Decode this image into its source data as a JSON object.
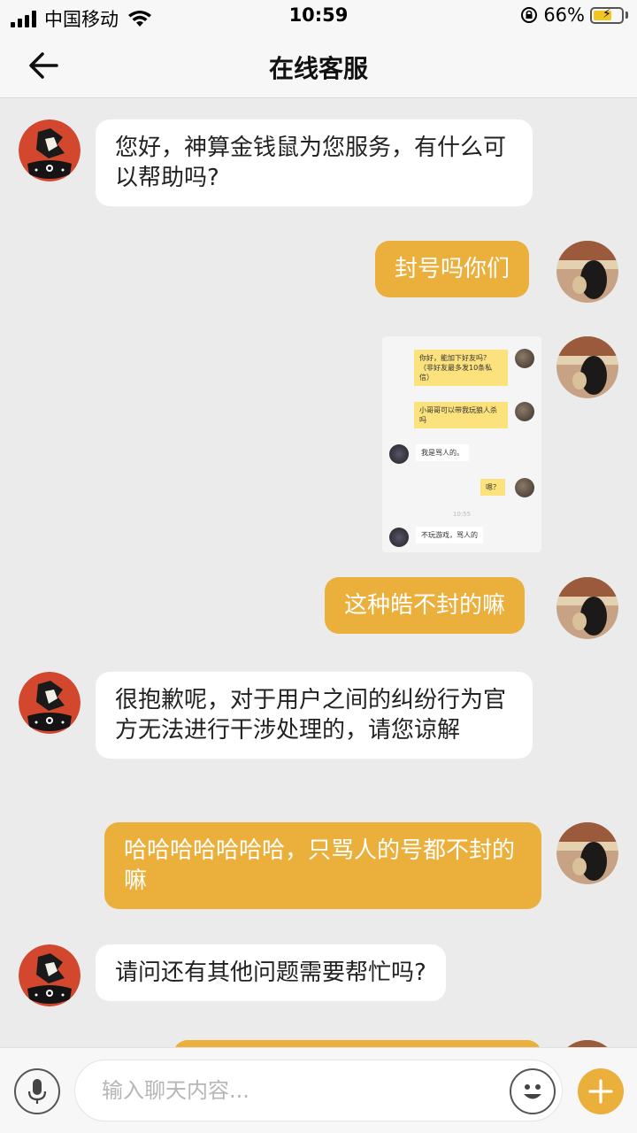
{
  "status_bar": {
    "carrier": "中国移动",
    "time": "10:59",
    "battery_percent": "66%",
    "battery_level": 0.66
  },
  "header": {
    "title": "在线客服",
    "back_icon": "back-arrow-icon"
  },
  "colors": {
    "accent": "#ebaf3b",
    "background": "#ebebeb",
    "incoming_bubble": "#ffffff"
  },
  "messages": [
    {
      "from": "agent",
      "text": "您好，神算金钱鼠为您服务，有什么可以帮助吗?"
    },
    {
      "from": "user",
      "text": "封号吗你们"
    },
    {
      "from": "user",
      "type": "image"
    },
    {
      "from": "user",
      "text": "这种皓不封的嘛"
    },
    {
      "from": "agent",
      "text": "很抱歉呢，对于用户之间的纠纷行为官方无法进行干涉处理的，请您谅解"
    },
    {
      "from": "user",
      "text": "哈哈哈哈哈哈哈，只骂人的号都不封的嘛"
    },
    {
      "from": "agent",
      "text": "请问还有其他问题需要帮忙吗?"
    }
  ],
  "embedded_screenshot": {
    "messages": [
      {
        "from": "user",
        "text": "你好，能加下好友吗？（非好友最多发10条私信）"
      },
      {
        "from": "user",
        "text": "小哥哥可以带我玩狼人杀吗"
      },
      {
        "from": "other",
        "text": "我是骂人的。"
      },
      {
        "from": "user",
        "text": "嗯？"
      },
      {
        "from": "other",
        "text": "不玩游戏，骂人的"
      }
    ],
    "timestamp": "10:55"
  },
  "input_bar": {
    "placeholder": "输入聊天内容...",
    "value": "",
    "mic_icon": "microphone-icon",
    "emoji_icon": "emoji-icon",
    "plus_icon": "plus-icon"
  }
}
